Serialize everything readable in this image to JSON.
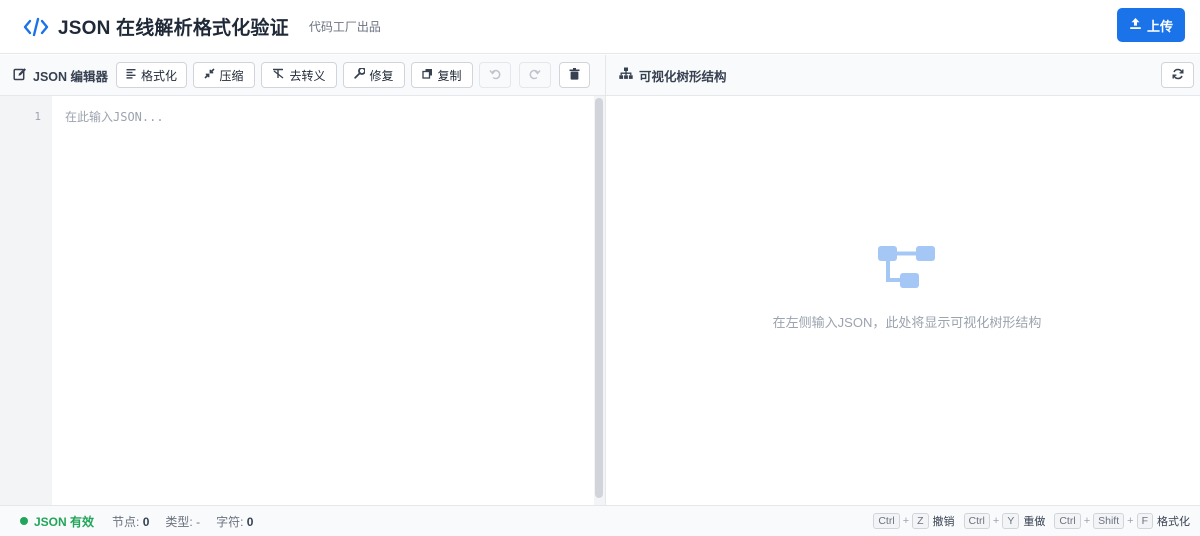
{
  "header": {
    "title": "JSON 在线解析格式化验证",
    "subtitle": "代码工厂出品",
    "upload_label": "上传",
    "logo_icon": "code-icon",
    "accent_color": "#1a73e8"
  },
  "editor": {
    "panel_title": "JSON 编辑器",
    "toolbar": {
      "format": "格式化",
      "compress": "压缩",
      "unescape": "去转义",
      "repair": "修复",
      "copy": "复制"
    },
    "line_numbers": [
      "1"
    ],
    "placeholder": "在此输入JSON..."
  },
  "tree": {
    "panel_title": "可视化树形结构",
    "empty_text": "在左侧输入JSON，此处将显示可视化树形结构"
  },
  "status": {
    "valid_text": "JSON 有效",
    "nodes_label": "节点:",
    "nodes_value": "0",
    "type_label": "类型:",
    "type_value": "-",
    "chars_label": "字符:",
    "chars_value": "0",
    "valid_color": "#22a55a"
  },
  "shortcuts": [
    {
      "keys": [
        "Ctrl",
        "Z"
      ],
      "label": "撤销"
    },
    {
      "keys": [
        "Ctrl",
        "Y"
      ],
      "label": "重做"
    },
    {
      "keys": [
        "Ctrl",
        "Shift",
        "F"
      ],
      "label": "格式化"
    }
  ]
}
